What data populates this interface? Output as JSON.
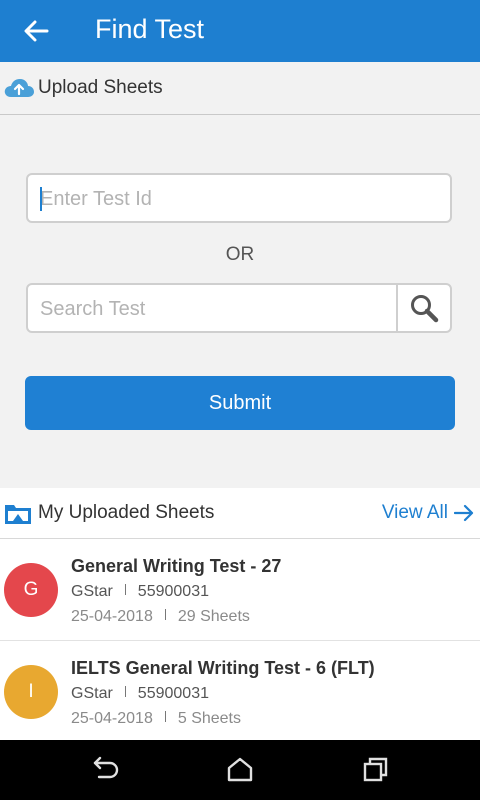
{
  "appbar": {
    "title": "Find Test",
    "back_icon": "arrow-left-icon"
  },
  "upload": {
    "label": "Upload Sheets",
    "icon": "cloud-upload-icon",
    "icon_color": "#4aa0d8"
  },
  "form": {
    "test_id_placeholder": "Enter Test Id",
    "test_id_value": "",
    "or_text": "OR",
    "search_placeholder": "Search Test",
    "search_value": "",
    "submit_label": "Submit"
  },
  "uploaded": {
    "title": "My Uploaded Sheets",
    "view_all_label": "View All",
    "items": [
      {
        "avatar_letter": "G",
        "avatar_color": "#e4474c",
        "name": "General Writing Test - 27",
        "org": "GStar",
        "code": "55900031",
        "date": "25-04-2018",
        "sheets": "29 Sheets"
      },
      {
        "avatar_letter": "I",
        "avatar_color": "#e8a830",
        "name": "IELTS General Writing Test - 6 (FLT)",
        "org": "GStar",
        "code": "55900031",
        "date": "25-04-2018",
        "sheets": "5 Sheets"
      }
    ]
  },
  "colors": {
    "primary": "#1e7fd0",
    "background": "#f2f2f2"
  }
}
